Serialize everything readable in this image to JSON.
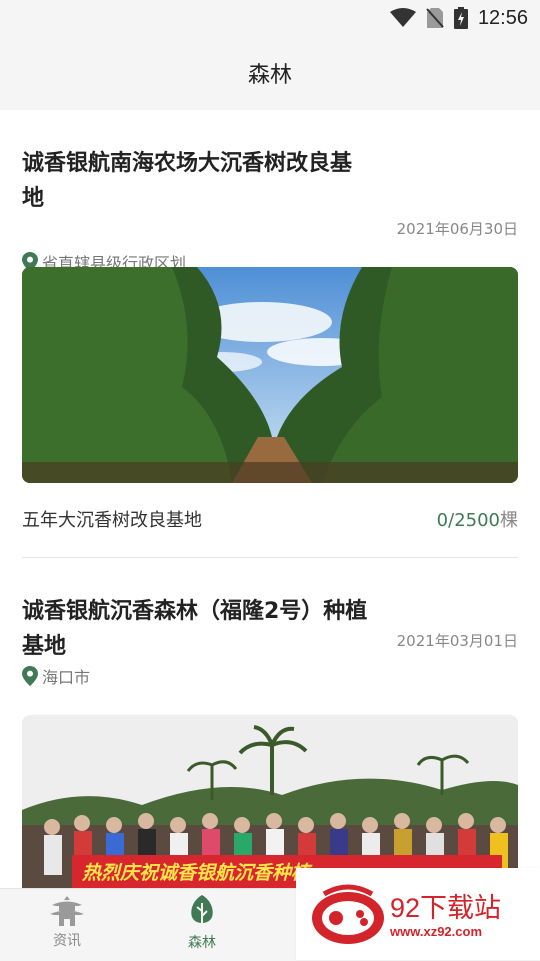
{
  "status_bar": {
    "time": "12:56",
    "icons": [
      "wifi-icon",
      "no-sim-icon",
      "battery-charging-icon"
    ]
  },
  "header": {
    "title": "森林"
  },
  "cards": [
    {
      "title": "诚香银航南海农场大沉香树改良基地",
      "date": "2021年06月30日",
      "location": "省直辖县级行政区划",
      "subtitle": "五年大沉香树改良基地",
      "count": "0/2500",
      "unit": "棵"
    },
    {
      "title": "诚香银航沉香森林（福隆2号）种植基地",
      "date": "2021年03月01日",
      "location": "海口市",
      "banner_text": "热烈庆祝诚香银航沉香种植"
    }
  ],
  "tabbar": {
    "tabs": [
      {
        "label": "资讯",
        "icon": "pagoda-icon",
        "active": false
      },
      {
        "label": "森林",
        "icon": "tree-icon",
        "active": true
      }
    ]
  },
  "watermark": {
    "text": "92下载站",
    "url": "www.xz92.com"
  },
  "colors": {
    "accent": "#3f7a55",
    "text": "#222222",
    "muted": "#888888",
    "background": "#f5f5f5",
    "watermark": "#d3242b"
  }
}
